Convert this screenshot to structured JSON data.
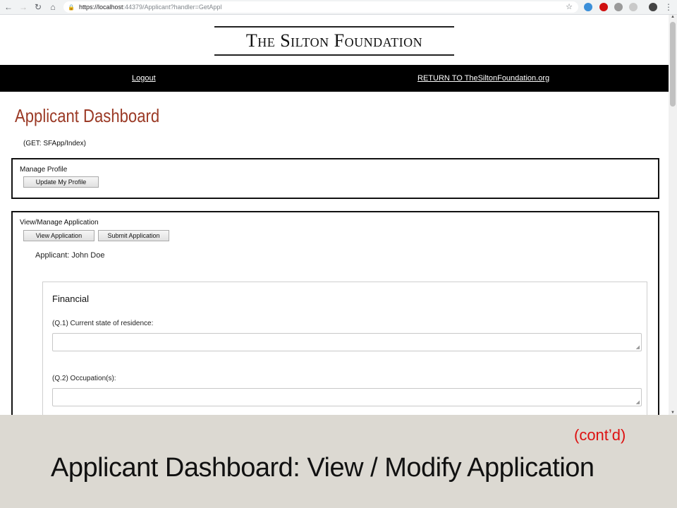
{
  "browser": {
    "url_host": "https://localhost",
    "url_path": ":44379/Applicant?handler=GetAppl",
    "lock_icon": "lock-icon",
    "back_icon": "back-arrow-icon",
    "forward_icon": "forward-arrow-icon",
    "reload_icon": "reload-icon",
    "home_icon": "home-icon",
    "star_icon": "star-icon"
  },
  "site": {
    "logo_text": "The Silton Foundation",
    "nav": {
      "logout": "Logout",
      "return": "RETURN TO TheSiltonFoundation.org"
    }
  },
  "dashboard": {
    "title": "Applicant Dashboard",
    "subtitle": "(GET: SFApp/Index)"
  },
  "manage_profile": {
    "label": "Manage Profile",
    "update_button": "Update My Profile"
  },
  "view_manage": {
    "label": "View/Manage Application",
    "view_button": "View Application",
    "submit_button": "Submit Application",
    "applicant": "Applicant: John Doe"
  },
  "financial": {
    "title": "Financial",
    "q1": "(Q.1) Current state of residence:",
    "q2": "(Q.2) Occupation(s):"
  },
  "slide": {
    "contd": "(cont’d)",
    "title": "Applicant Dashboard: View / Modify Application"
  },
  "colors": {
    "title_accent": "#9b3a26",
    "nav_bar": "#000000",
    "footer_bg": "#dcd9d2",
    "contd_red": "#dd1111"
  }
}
